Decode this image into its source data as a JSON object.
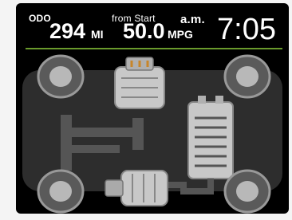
{
  "header": {
    "odo_label": "ODO",
    "odo_value": "294",
    "odo_unit": "MI",
    "from_start_label": "from Start",
    "mpg_value": "50.0",
    "mpg_unit": "MPG",
    "meridiem": "a.m.",
    "time": "7:05"
  },
  "diagram": {
    "components": [
      "engine",
      "battery",
      "motor",
      "wheel-front-left",
      "wheel-front-right",
      "wheel-rear-left",
      "wheel-rear-right"
    ]
  },
  "colors": {
    "background": "#000000",
    "accent_rule": "#6a9a2c",
    "body_fill": "#2d2d2d",
    "component_fill": "#c8c8c8"
  }
}
